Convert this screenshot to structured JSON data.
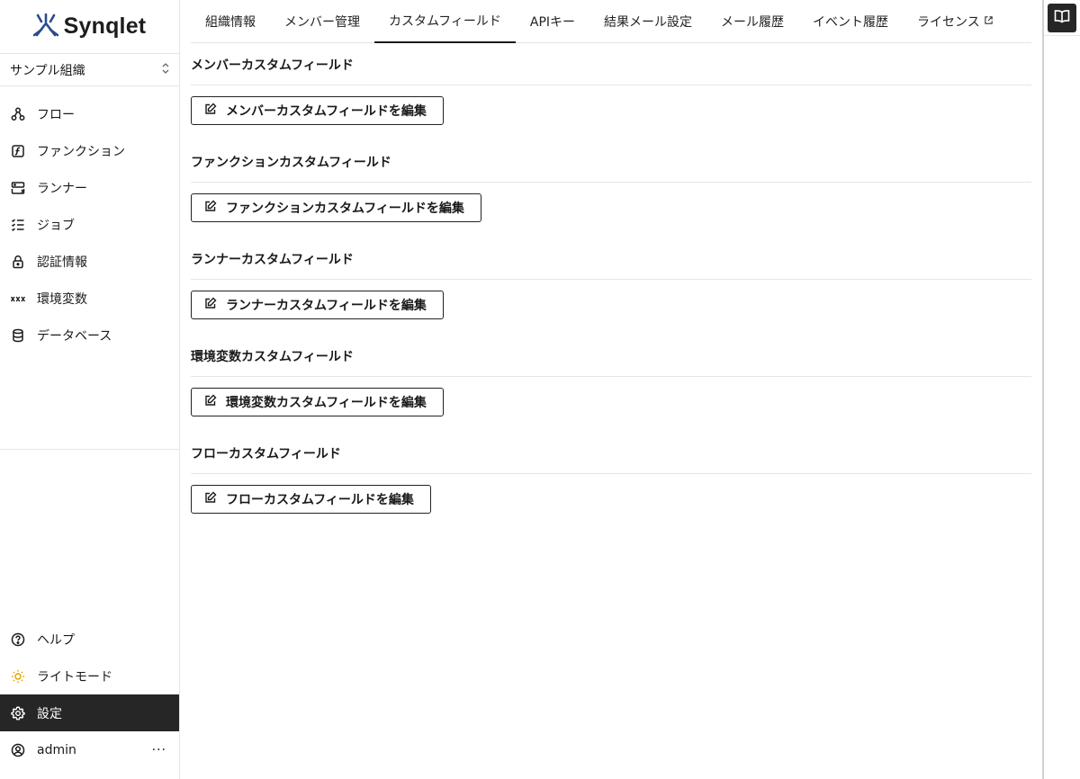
{
  "brand": {
    "name": "Synqlet"
  },
  "org_selector": {
    "value": "サンプル組織"
  },
  "nav": {
    "items": [
      {
        "label": "フロー",
        "icon": "flow-icon"
      },
      {
        "label": "ファンクション",
        "icon": "function-icon"
      },
      {
        "label": "ランナー",
        "icon": "server-icon"
      },
      {
        "label": "ジョブ",
        "icon": "list-check-icon"
      },
      {
        "label": "認証情報",
        "icon": "lock-icon"
      },
      {
        "label": "環境変数",
        "icon": "variable-icon"
      },
      {
        "label": "データベース",
        "icon": "database-icon"
      }
    ]
  },
  "bottom_nav": {
    "help": "ヘルプ",
    "theme": "ライトモード",
    "settings": "設定",
    "user": "admin",
    "more": "···"
  },
  "tabs": [
    {
      "label": "組織情報"
    },
    {
      "label": "メンバー管理"
    },
    {
      "label": "カスタムフィールド"
    },
    {
      "label": "APIキー"
    },
    {
      "label": "結果メール設定"
    },
    {
      "label": "メール履歴"
    },
    {
      "label": "イベント履歴"
    },
    {
      "label": "ライセンス"
    }
  ],
  "active_tab": "カスタムフィールド",
  "sections": [
    {
      "title": "メンバーカスタムフィールド",
      "button": "メンバーカスタムフィールドを編集"
    },
    {
      "title": "ファンクションカスタムフィールド",
      "button": "ファンクションカスタムフィールドを編集"
    },
    {
      "title": "ランナーカスタムフィールド",
      "button": "ランナーカスタムフィールドを編集"
    },
    {
      "title": "環境変数カスタムフィールド",
      "button": "環境変数カスタムフィールドを編集"
    },
    {
      "title": "フローカスタムフィールド",
      "button": "フローカスタムフィールドを編集"
    }
  ],
  "colors": {
    "active_bg": "#262626",
    "border": "#e5e5e5",
    "logo_blue": "#2b4c8c",
    "sun": "#e0a100"
  }
}
